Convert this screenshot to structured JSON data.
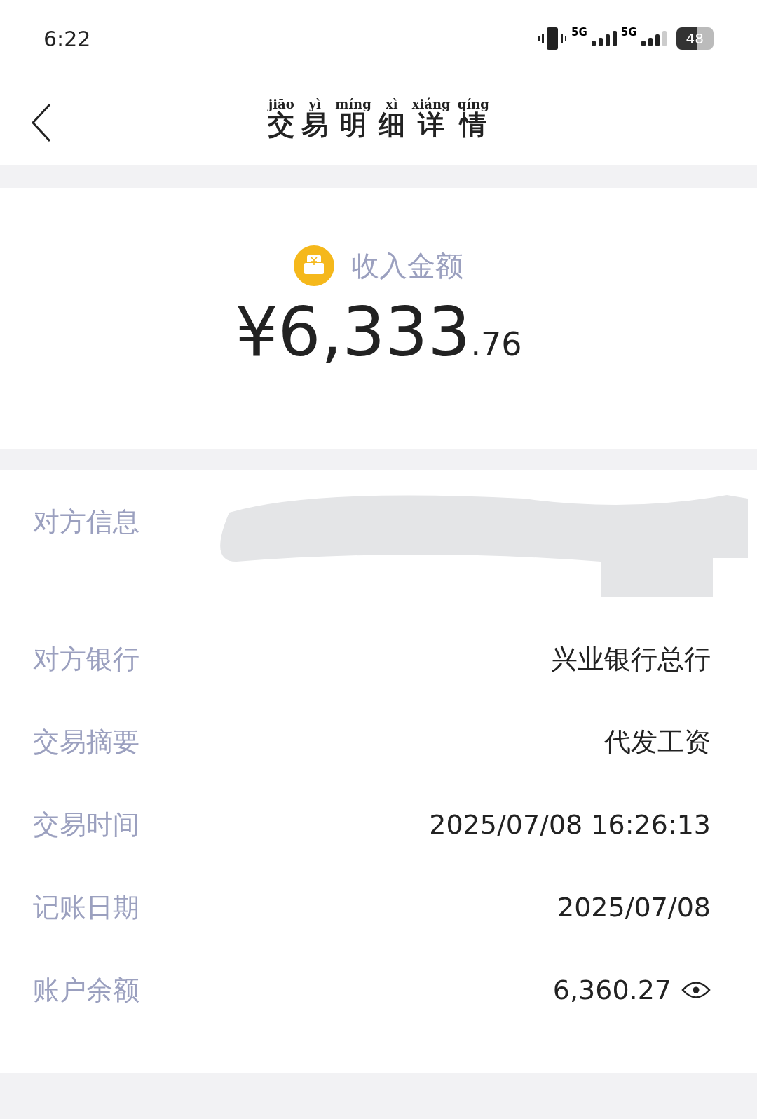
{
  "status_bar": {
    "time": "6:22",
    "network_1": "5G",
    "network_2": "5G",
    "battery": "48"
  },
  "header": {
    "title": [
      {
        "char": "交",
        "pinyin": "jiāo"
      },
      {
        "char": "易",
        "pinyin": "yì"
      },
      {
        "char": "明",
        "pinyin": "míng"
      },
      {
        "char": "细",
        "pinyin": "xì"
      },
      {
        "char": "详",
        "pinyin": "xiáng"
      },
      {
        "char": "情",
        "pinyin": "qíng"
      }
    ]
  },
  "amount": {
    "label": "收入金额",
    "integer": "¥6,333",
    "decimal": ".76"
  },
  "details": [
    {
      "kind": "redacted",
      "label": "对方信息"
    },
    {
      "kind": "text",
      "label": "对方银行",
      "value": "兴业银行总行"
    },
    {
      "kind": "text",
      "label": "交易摘要",
      "value": "代发工资"
    },
    {
      "kind": "text",
      "label": "交易时间",
      "value": "2025/07/08 16:26:13"
    },
    {
      "kind": "text",
      "label": "记账日期",
      "value": "2025/07/08"
    },
    {
      "kind": "balance",
      "label": "账户余额",
      "value": "6,360.27"
    }
  ]
}
